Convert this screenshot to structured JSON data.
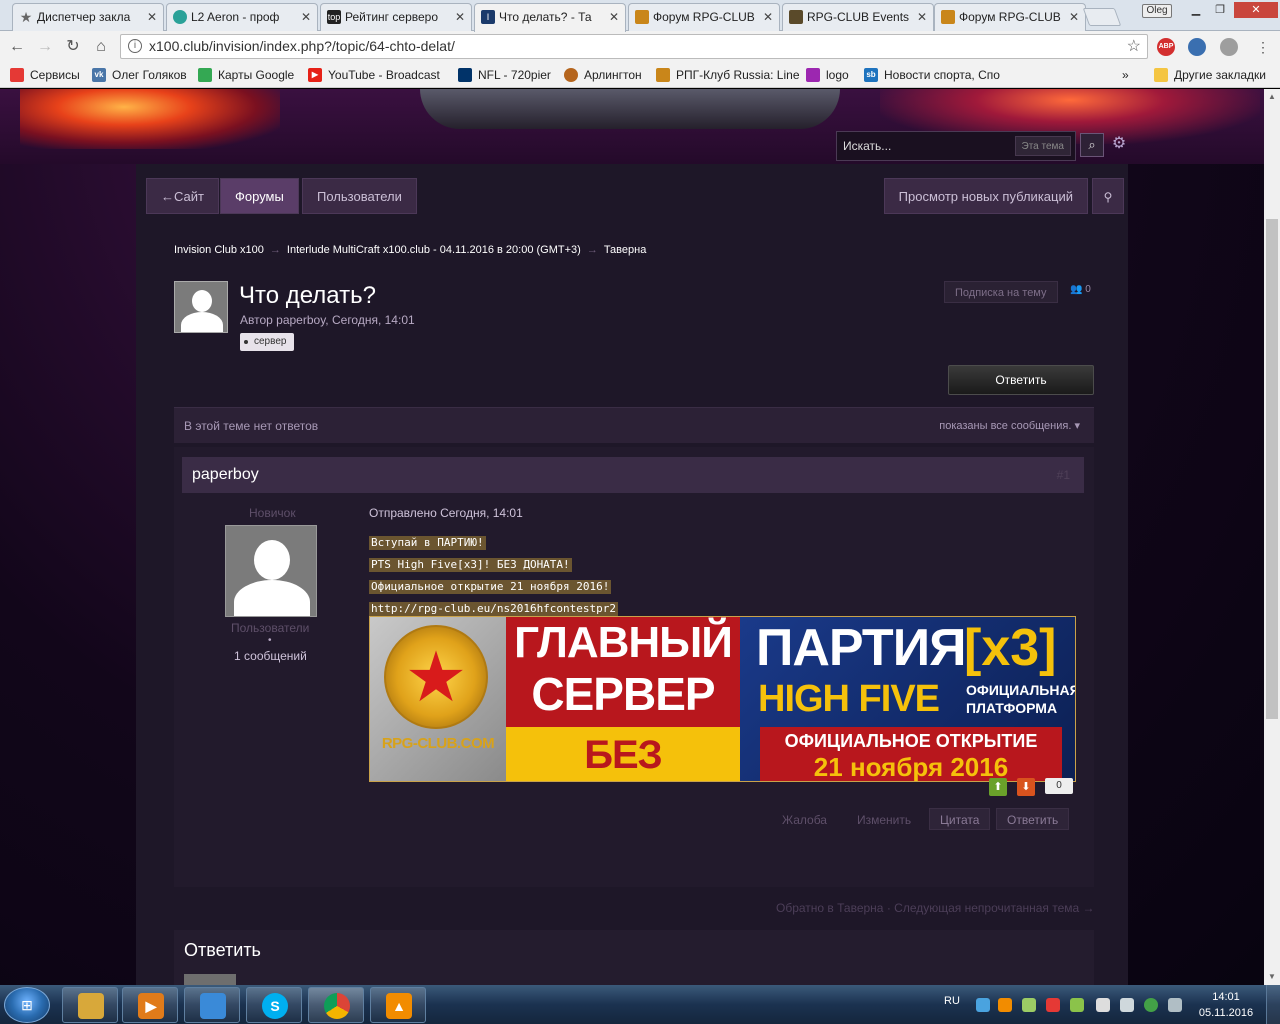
{
  "browser": {
    "tabs": [
      {
        "title": "Диспетчер закла",
        "icon": "star-icon",
        "color": "#666666",
        "active": false
      },
      {
        "title": "L2 Aeron - проф",
        "icon": "l2-icon",
        "color": "#2aa198",
        "active": false
      },
      {
        "title": "Рейтинг серверо",
        "icon": "top-icon",
        "color": "#222222",
        "active": false
      },
      {
        "title": "Что делать? - Та",
        "icon": "invision-icon",
        "color": "#1b3a6b",
        "active": true
      },
      {
        "title": "Форум RPG-CLUB",
        "icon": "rpgclub-icon",
        "color": "#c9861a",
        "active": false
      },
      {
        "title": "RPG-CLUB Events",
        "icon": "events-icon",
        "color": "#5a4a2a",
        "active": false
      },
      {
        "title": "Форум RPG-CLUB",
        "icon": "rpgclub-icon",
        "color": "#c9861a",
        "active": false
      }
    ],
    "profile": "Oleg",
    "url": "x100.club/invision/index.php?/topic/64-chto-delat/",
    "bookmarks": [
      {
        "label": "Сервисы",
        "color": "#e53935"
      },
      {
        "label": "Олег Голяков",
        "color": "#4a76a8"
      },
      {
        "label": "Карты Google",
        "color": "#34a853"
      },
      {
        "label": "YouTube - Broadcast",
        "color": "#e62117"
      },
      {
        "label": "NFL - 720pier",
        "color": "#013369"
      },
      {
        "label": "Арлингтон",
        "color": "#b5651d"
      },
      {
        "label": "РПГ-Клуб Russia: Line",
        "color": "#c9861a"
      },
      {
        "label": "logo",
        "color": "#9c27b0"
      },
      {
        "label": "Новости спорта, Спо",
        "color": "#1e73be"
      }
    ],
    "bookmarks_more": "»",
    "other_bookmarks": "Другие закладки"
  },
  "forum": {
    "search_placeholder": "Искать...",
    "search_scope": "Эта тема",
    "nav": {
      "site": "←Сайт",
      "forums": "Форумы",
      "users": "Пользователи",
      "new_posts": "Просмотр новых публикаций"
    },
    "breadcrumb": [
      "Invision Club x100",
      "Interlude MultiCraft x100.club - 04.11.2016 в 20:00 (GMT+3)",
      "Таверна"
    ],
    "breadcrumb_sep": "→",
    "topic": {
      "title": "Что делать?",
      "meta": "Автор paperboy, Сегодня, 14:01",
      "tag": "сервер",
      "follow": "Подписка на тему",
      "followers": "0",
      "reply": "Ответить"
    },
    "infobar": {
      "left": "В этой теме нет ответов",
      "right": "показаны все сообщения."
    },
    "post": {
      "author": "paperboy",
      "number": "#1",
      "rank": "Новичок",
      "group": "Пользователи",
      "dot": "•",
      "post_count": "1 сообщений",
      "posted": "Отправлено Сегодня, 14:01",
      "lines": [
        "Вступай в ПАРТИЮ!",
        "PTS High Five[x3]! БЕЗ ДОНАТА!",
        "Официальное открытие 21 ноября 2016!",
        "http://rpg-club.eu/ns2016hfcontestpr2"
      ],
      "banner": {
        "brand": "RPG-CLUB.COM",
        "main1": "ГЛАВНЫЙ",
        "main2": "СЕРВЕР",
        "no_donate": "БЕЗ ДОНАТА",
        "party": "ПАРТИЯ",
        "x3": "[x3]",
        "high_five": "HIGH FIVE",
        "official": "ОФИЦИАЛЬНАЯ ПЛАТФОРМА",
        "opening": "ОФИЦИАЛЬНОЕ ОТКРЫТИЕ",
        "date": "21 ноября 2016"
      },
      "reputation": "0",
      "actions": {
        "report": "Жалоба",
        "edit": "Изменить",
        "quote": "Цитата",
        "reply": "Ответить"
      }
    },
    "bottom_nav": {
      "back": "Обратно в Таверна",
      "sep": "·",
      "next": "Следующая непрочитанная тема →"
    },
    "reply_heading": "Ответить"
  },
  "taskbar": {
    "lang": "RU",
    "time": "14:01",
    "date": "05.11.2016",
    "apps": [
      {
        "name": "explorer-icon",
        "color": "#d8a83a"
      },
      {
        "name": "media-player-icon",
        "color": "#e07b1a"
      },
      {
        "name": "paint-icon",
        "color": "#3a8ad8"
      },
      {
        "name": "skype-icon",
        "color": "#00aff0"
      },
      {
        "name": "chrome-icon",
        "color": "#4285f4"
      },
      {
        "name": "vlc-icon",
        "color": "#f28c00"
      }
    ]
  }
}
